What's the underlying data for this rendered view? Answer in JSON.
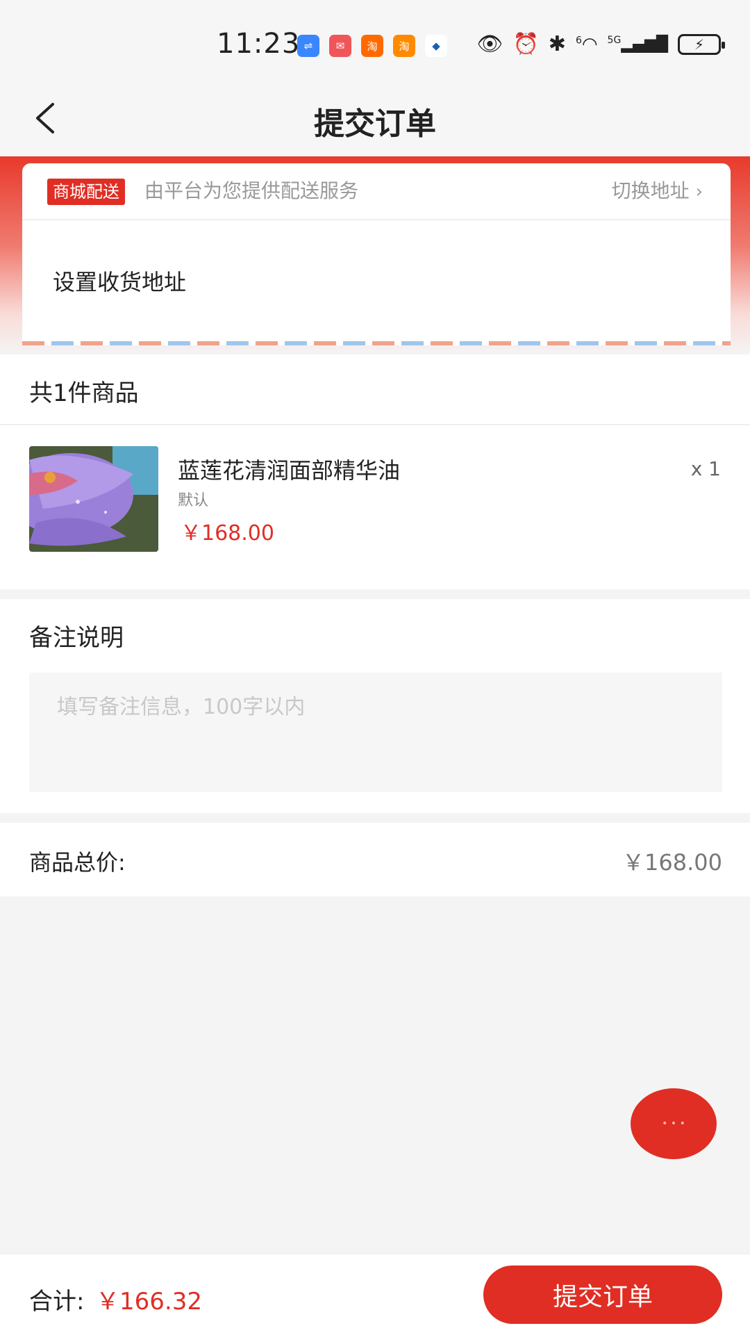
{
  "status_bar": {
    "time": "11:23",
    "app_icons": [
      {
        "icon": "usb-icon",
        "glyph": "⇌",
        "color": "#3a86ff"
      },
      {
        "icon": "huawei-icon",
        "glyph": "✉",
        "color": "#f0555a"
      },
      {
        "icon": "taobao-icon",
        "glyph": "淘",
        "color": "#ff6a00"
      },
      {
        "icon": "taobao-flash-icon",
        "glyph": "淘",
        "color": "#ff8a00"
      },
      {
        "icon": "bank-icon",
        "glyph": "◆",
        "color": "#1a5fb4"
      }
    ],
    "network": "5G",
    "wifi_badge": "6"
  },
  "header": {
    "title": "提交订单"
  },
  "address": {
    "badge": "商城配送",
    "description": "由平台为您提供配送服务",
    "switch_label": "切换地址",
    "set_address": "设置收货地址"
  },
  "goods": {
    "count_label": "共1件商品",
    "items": [
      {
        "name": "蓝莲花清润面部精华油",
        "spec": "默认",
        "price": "￥168.00",
        "qty": "x 1"
      }
    ]
  },
  "remark": {
    "title": "备注说明",
    "placeholder": "填写备注信息，100字以内",
    "value": ""
  },
  "total": {
    "label": "商品总价:",
    "value": "￥168.00"
  },
  "bottom_bar": {
    "sum_label": "合计:",
    "sum_value": "￥166.32",
    "submit_label": "提交订单"
  },
  "colors": {
    "accent": "#e02e24",
    "background": "#f4f4f4"
  }
}
